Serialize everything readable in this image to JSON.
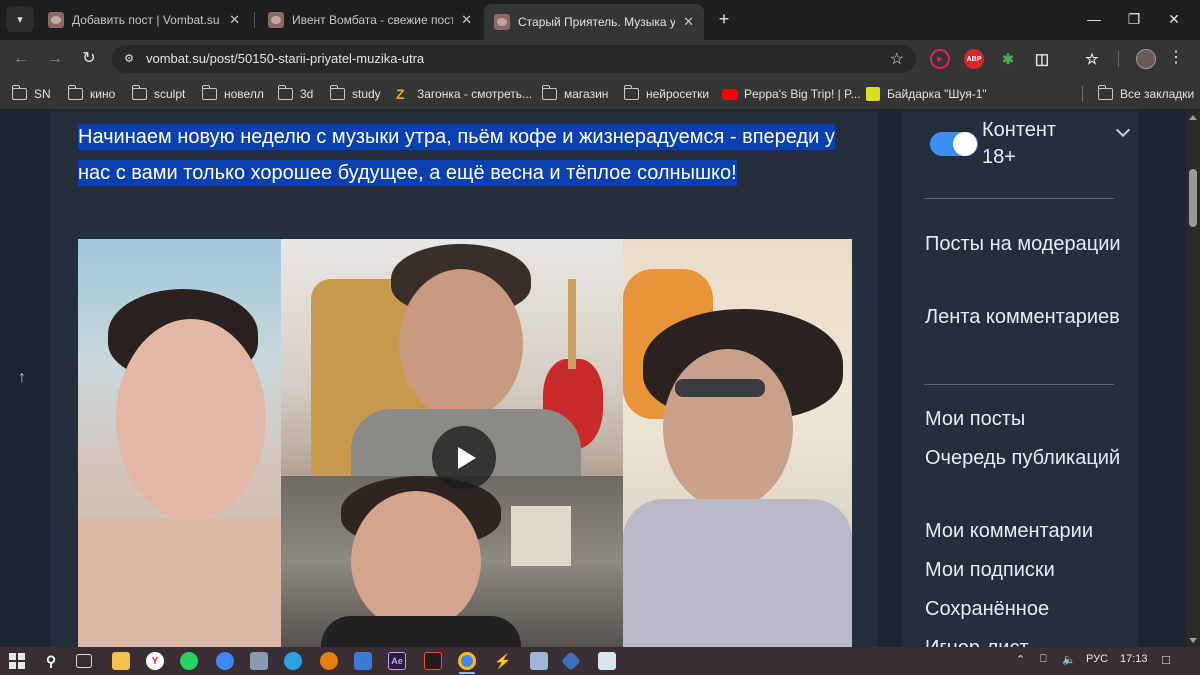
{
  "browser": {
    "tabs": [
      {
        "title": "Добавить пост | Vombat.su",
        "active": false
      },
      {
        "title": "Ивент Вомбата - свежие посты",
        "active": false
      },
      {
        "title": "Старый Приятель. Музыка утра",
        "active": true
      }
    ],
    "url": "vombat.su/post/50150-starii-priyatel-muzika-utra",
    "bookmarks": [
      {
        "label": "SN",
        "icon": "folder-icon"
      },
      {
        "label": "кино",
        "icon": "folder-icon"
      },
      {
        "label": "sculpt",
        "icon": "folder-icon"
      },
      {
        "label": "новелл",
        "icon": "folder-icon"
      },
      {
        "label": "3d",
        "icon": "folder-icon"
      },
      {
        "label": "study",
        "icon": "folder-icon"
      },
      {
        "label": "Загонка - смотреть...",
        "icon": "zagonka-icon"
      },
      {
        "label": "магазин",
        "icon": "folder-icon"
      },
      {
        "label": "нейросетки",
        "icon": "folder-icon"
      },
      {
        "label": "Peppa's Big Trip! | P...",
        "icon": "youtube-icon"
      },
      {
        "label": "Байдарка \"Шуя-1\"",
        "icon": "kayak-icon"
      }
    ],
    "all_bookmarks": "Все закладки",
    "extensions": {
      "abp_label": "ABP"
    }
  },
  "article": {
    "lead_text": "Начинаем новую неделю с музыки утра, пьём кофе и жизнерадуемся - впереди у нас с вами только хорошее будущее, а ещё весна и тёплое солнышко!"
  },
  "sidebar": {
    "toggle_label": "Контент 18+",
    "toggle_on": true,
    "links_group1": [
      "Посты на модерации",
      "Лента комментариев"
    ],
    "links_group2": [
      "Мои посты",
      "Очередь публикаций",
      "Мои комментарии",
      "Мои подписки",
      "Сохранённое",
      "Игнор-лист"
    ]
  },
  "taskbar": {
    "language": "РУС",
    "time": "17:13"
  },
  "colors": {
    "page_bg": "#1b2431",
    "card_bg": "#242e3d",
    "highlight": "#0b40b0",
    "toggle_on": "#3b8df0"
  }
}
